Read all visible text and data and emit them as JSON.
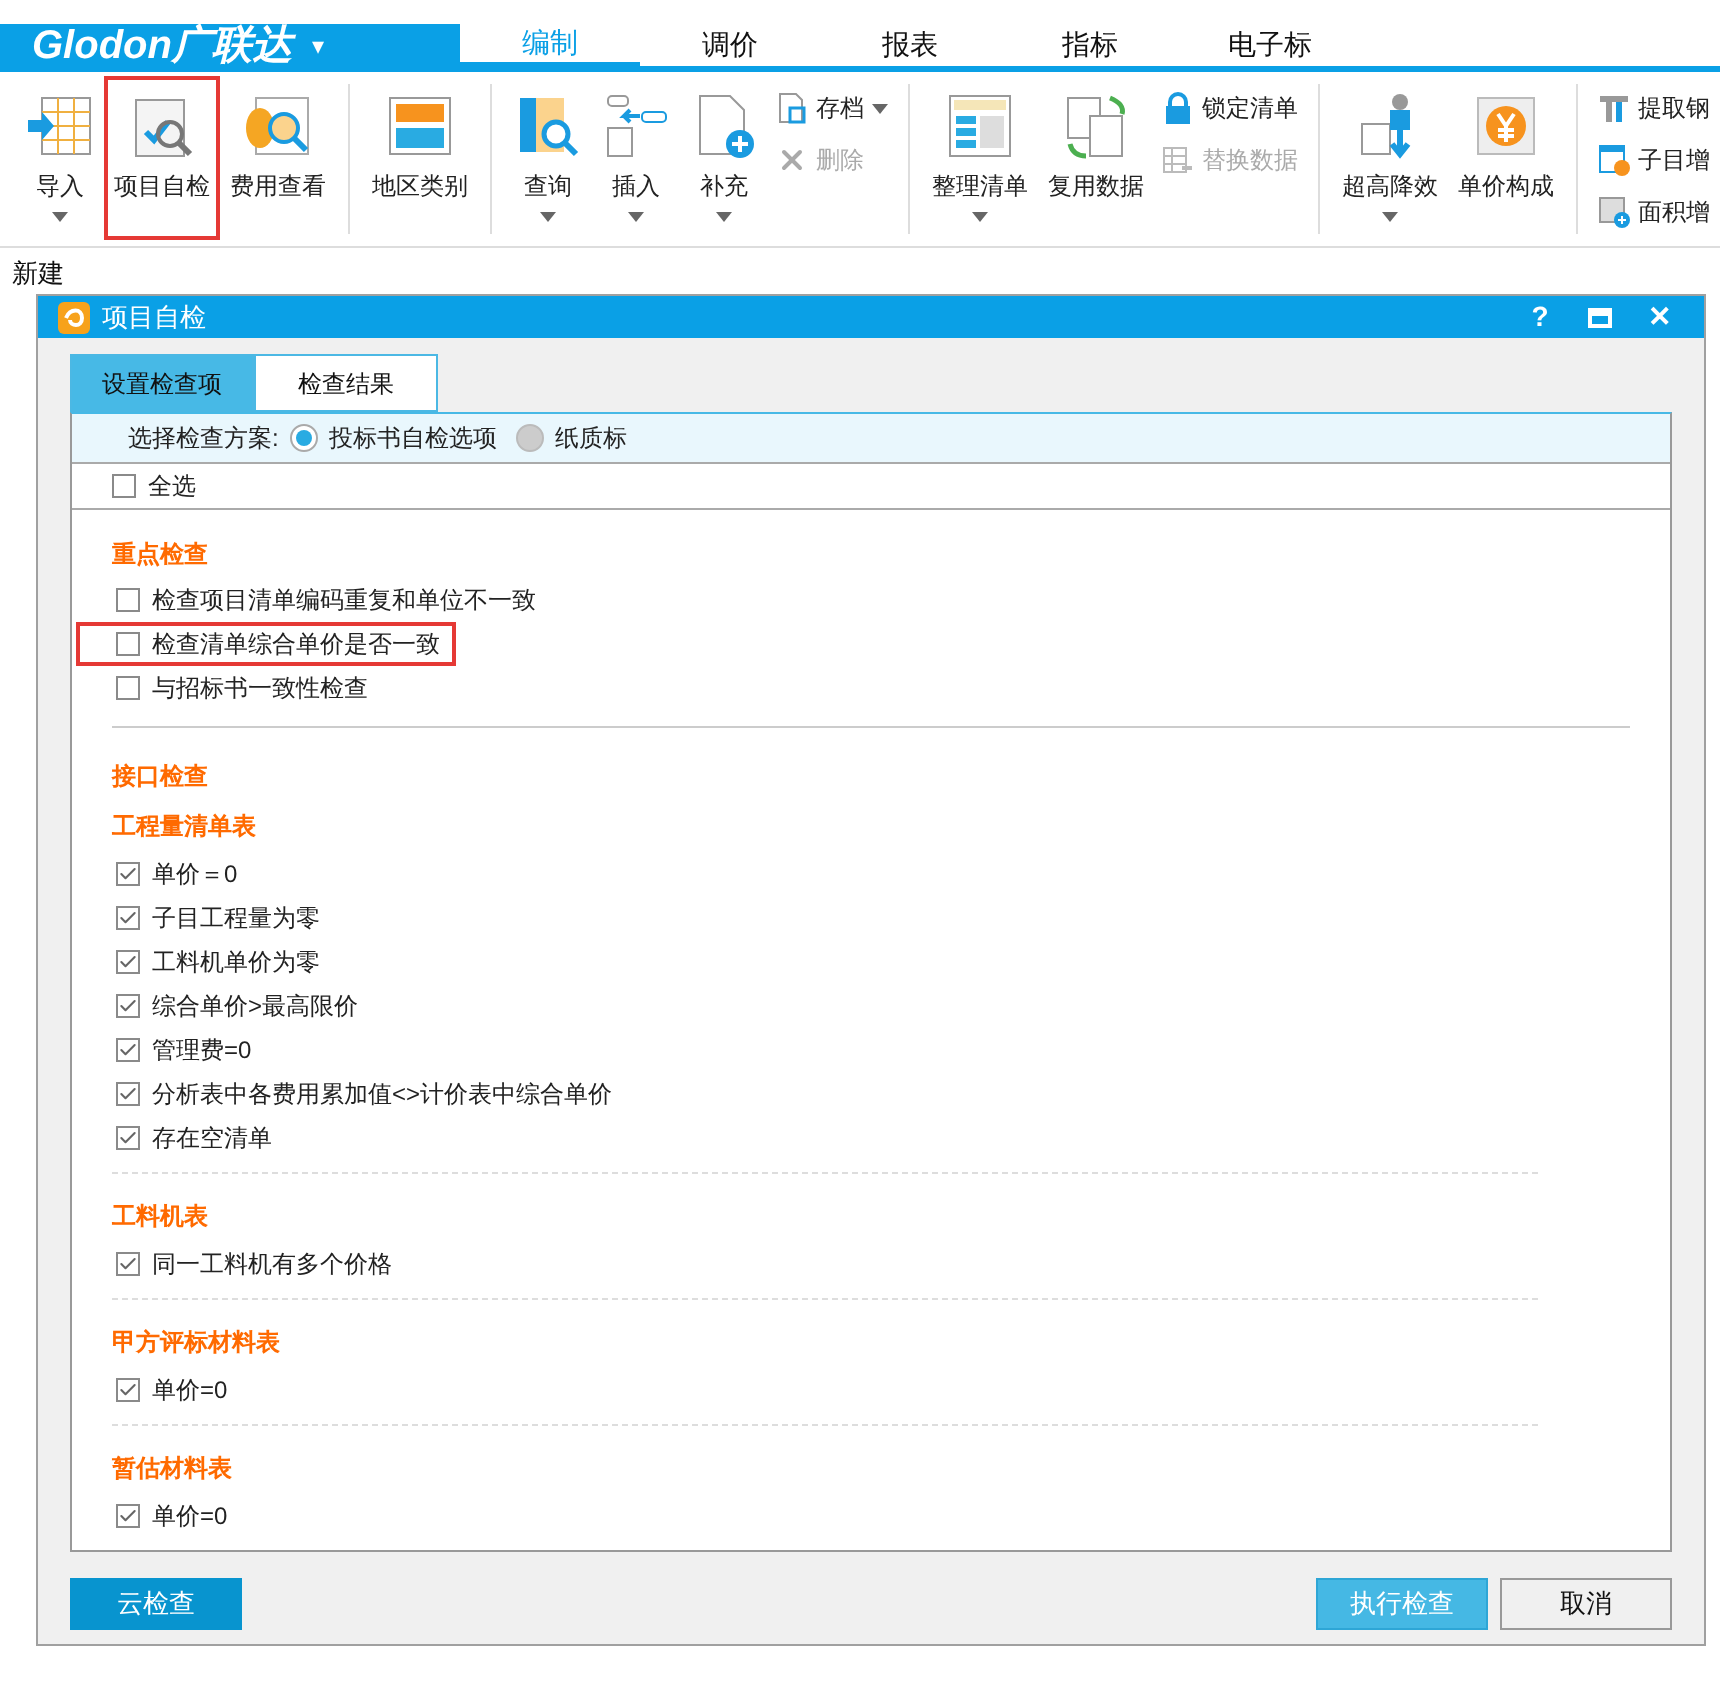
{
  "app": {
    "logo": "Glodon广联达",
    "logo_menu": "▾"
  },
  "menu_tabs": [
    {
      "label": "编制",
      "selected": true
    },
    {
      "label": "调价",
      "selected": false
    },
    {
      "label": "报表",
      "selected": false
    },
    {
      "label": "指标",
      "selected": false
    },
    {
      "label": "电子标",
      "selected": false
    }
  ],
  "ribbon": [
    {
      "kind": "large",
      "label": "导入",
      "dropdown": true,
      "highlighted": false
    },
    {
      "kind": "large",
      "label": "项目自检",
      "dropdown": false,
      "highlighted": true
    },
    {
      "kind": "large",
      "label": "费用查看",
      "dropdown": false,
      "highlighted": false
    },
    {
      "kind": "sep"
    },
    {
      "kind": "large",
      "label": "地区类别",
      "dropdown": false,
      "highlighted": false
    },
    {
      "kind": "sep"
    },
    {
      "kind": "large",
      "label": "查询",
      "dropdown": true,
      "highlighted": false
    },
    {
      "kind": "large",
      "label": "插入",
      "dropdown": true,
      "highlighted": false
    },
    {
      "kind": "large",
      "label": "补充",
      "dropdown": true,
      "highlighted": false
    },
    {
      "kind": "small",
      "items": [
        {
          "label": "存档",
          "dropdown": true,
          "disabled": false
        },
        {
          "label": "删除",
          "dropdown": false,
          "disabled": true
        }
      ]
    },
    {
      "kind": "sep"
    },
    {
      "kind": "large",
      "label": "整理清单",
      "dropdown": true,
      "highlighted": false
    },
    {
      "kind": "large",
      "label": "复用数据",
      "dropdown": false,
      "highlighted": false
    },
    {
      "kind": "small",
      "items": [
        {
          "label": "锁定清单",
          "dropdown": false,
          "disabled": false
        },
        {
          "label": "替换数据",
          "dropdown": false,
          "disabled": true
        }
      ]
    },
    {
      "kind": "sep"
    },
    {
      "kind": "large",
      "label": "超高降效",
      "dropdown": true,
      "highlighted": false
    },
    {
      "kind": "large",
      "label": "单价构成",
      "dropdown": false,
      "highlighted": false
    },
    {
      "kind": "sep"
    },
    {
      "kind": "small",
      "items": [
        {
          "label": "提取钢",
          "dropdown": false,
          "disabled": false
        },
        {
          "label": "子目增",
          "dropdown": false,
          "disabled": false
        },
        {
          "label": "面积增",
          "dropdown": false,
          "disabled": false
        }
      ]
    }
  ],
  "sub_bar": {
    "label": "新建"
  },
  "dialog": {
    "title": "项目自检",
    "help": "?",
    "close": "✕",
    "tabs": [
      {
        "label": "设置检查项",
        "selected": true
      },
      {
        "label": "检查结果",
        "selected": false
      }
    ],
    "scheme": {
      "label": "选择检查方案:",
      "options": [
        {
          "label": "投标书自检选项",
          "selected": true
        },
        {
          "label": "纸质标",
          "selected": false
        }
      ]
    },
    "select_all": {
      "label": "全选",
      "checked": false
    },
    "sections": [
      {
        "title": "重点检查",
        "items": [
          {
            "label": "检查项目清单编码重复和单位不一致",
            "checked": false,
            "highlighted": false
          },
          {
            "label": "检查清单综合单价是否一致",
            "checked": false,
            "highlighted": true
          },
          {
            "label": "与招标书一致性检查",
            "checked": false,
            "highlighted": false
          }
        ]
      },
      {
        "title": "接口检查",
        "groups": [
          {
            "title": "工程量清单表",
            "items": [
              {
                "label": "单价＝0",
                "checked": true,
                "highlighted": false
              },
              {
                "label": "子目工程量为零",
                "checked": true,
                "highlighted": false
              },
              {
                "label": "工料机单价为零",
                "checked": true,
                "highlighted": false
              },
              {
                "label": "综合单价>最高限价",
                "checked": true,
                "highlighted": false
              },
              {
                "label": "管理费=0",
                "checked": true,
                "highlighted": false
              },
              {
                "label": "分析表中各费用累加值<>计价表中综合单价",
                "checked": true,
                "highlighted": false
              },
              {
                "label": "存在空清单",
                "checked": true,
                "highlighted": false
              }
            ]
          },
          {
            "title": "工料机表",
            "items": [
              {
                "label": "同一工料机有多个价格",
                "checked": true,
                "highlighted": false
              }
            ]
          },
          {
            "title": "甲方评标材料表",
            "items": [
              {
                "label": "单价=0",
                "checked": true,
                "highlighted": false
              }
            ]
          },
          {
            "title": "暂估材料表",
            "items": [
              {
                "label": "单价=0",
                "checked": true,
                "highlighted": false
              }
            ]
          }
        ]
      }
    ],
    "buttons": [
      {
        "label": "云检查",
        "kind": "cloud"
      },
      {
        "label": "执行检查",
        "kind": "primary"
      },
      {
        "label": "取消",
        "kind": "default"
      }
    ]
  }
}
